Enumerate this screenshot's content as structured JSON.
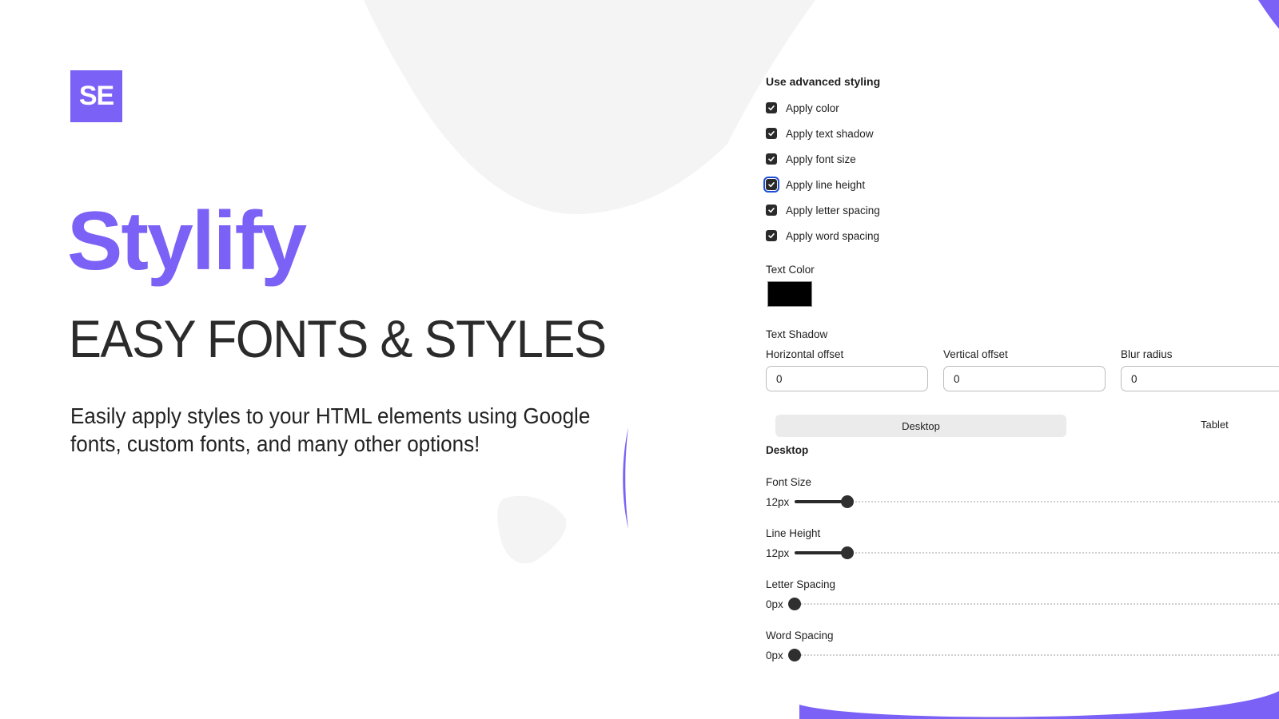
{
  "colors": {
    "accent": "#7b61f5",
    "shape_gray": "#f4f4f4",
    "checkbox": "#2a2a2a",
    "focus_ring": "#1f4fd6",
    "text_color_value": "#000000"
  },
  "hero": {
    "logo_text": "SE",
    "brand": "Stylify",
    "tagline": "EASY FONTS & STYLES",
    "description": "Easily apply styles to your HTML elements using Google fonts, custom fonts, and many other options!"
  },
  "panel": {
    "section_title": "Use advanced styling",
    "checkboxes": [
      {
        "label": "Apply color",
        "checked": true,
        "focused": false
      },
      {
        "label": "Apply text shadow",
        "checked": true,
        "focused": false
      },
      {
        "label": "Apply font size",
        "checked": true,
        "focused": false
      },
      {
        "label": "Apply line height",
        "checked": true,
        "focused": true
      },
      {
        "label": "Apply letter spacing",
        "checked": true,
        "focused": false
      },
      {
        "label": "Apply word spacing",
        "checked": true,
        "focused": false
      }
    ],
    "text_color": {
      "label": "Text Color",
      "value": "#000000"
    },
    "text_shadow": {
      "label": "Text Shadow",
      "fields": [
        {
          "label": "Horizontal offset",
          "value": "0"
        },
        {
          "label": "Vertical offset",
          "value": "0"
        },
        {
          "label": "Blur radius",
          "value": "0"
        }
      ]
    },
    "device_tabs": [
      {
        "label": "Desktop",
        "selected": true
      },
      {
        "label": "Tablet",
        "selected": false
      }
    ],
    "device_title": "Desktop",
    "sliders": [
      {
        "label": "Font Size",
        "value_text": "12px",
        "value": 12,
        "fraction": 0.11
      },
      {
        "label": "Line Height",
        "value_text": "12px",
        "value": 12,
        "fraction": 0.11
      },
      {
        "label": "Letter Spacing",
        "value_text": "0px",
        "value": 0,
        "fraction": 0
      },
      {
        "label": "Word Spacing",
        "value_text": "0px",
        "value": 0,
        "fraction": 0
      }
    ]
  }
}
